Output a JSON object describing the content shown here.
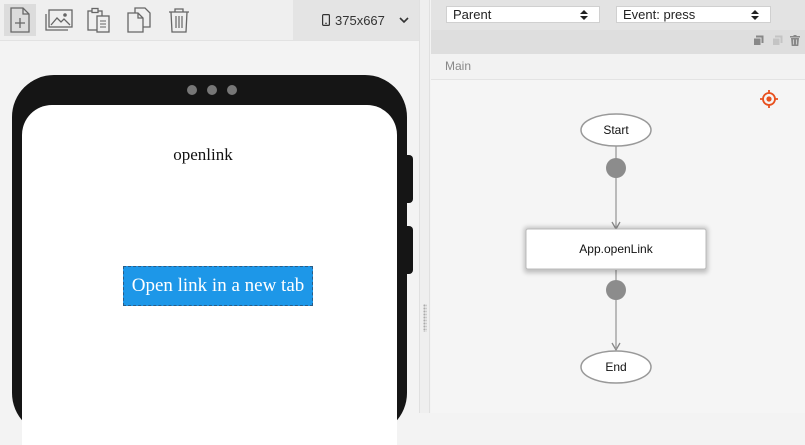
{
  "toolbar": {
    "buttons": [
      {
        "icon": "new-page-icon"
      },
      {
        "icon": "image-icon"
      },
      {
        "icon": "paste-icon"
      },
      {
        "icon": "duplicate-icon"
      },
      {
        "icon": "trash-icon"
      }
    ],
    "device": {
      "icon": "phone-icon",
      "label": "375x667"
    }
  },
  "preview": {
    "title": "openlink",
    "button_label": "Open link in a new tab"
  },
  "logic": {
    "component_select": "Parent",
    "event_select": "Event: press",
    "tab": "Main",
    "tools": [
      "copy-icon",
      "paste-icon",
      "trash-icon"
    ],
    "nodes": {
      "start": "Start",
      "action": "App.openLink",
      "end": "End"
    }
  },
  "colors": {
    "accent_button": "#1d97e8",
    "target_icon": "#e8501e"
  }
}
